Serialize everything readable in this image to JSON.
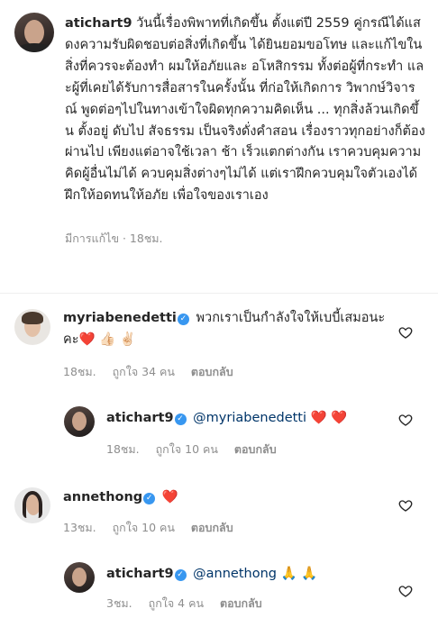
{
  "post": {
    "username": "atichart9",
    "text": "วันนี้เรื่องพิพาทที่เกิดขึ้น ตั้งแต่ปี 2559 คู่กรณีได้แสดงความรับผิดชอบต่อสิ่งที่เกิดขึ้น ได้ยินยอมขอโทษ และแก้ไขในสิ่งที่ควรจะต้องทำ ผมให้อภัยและ อโหสิกรรม ทั้งต่อผู้ที่กระทำ และผู้ที่เคยได้รับการสื่อสารในครั้งนั้น ที่ก่อให้เกิดการ วิพากษ์วิจารณ์ พูดต่อๆไปในทางเข้าใจผิดทุกความคิดเห็น ... ทุกสิ่งล้วนเกิดขึ้น ตั้งอยู่ ดับไป สัจธรรม เป็นจริงดั่งคำสอน เรื่องราวทุกอย่างก็ต้องผ่านไป เพียงแต่อาจใช้เวลา ช้า เร็วแตกต่างกัน เราควบคุมความคิดผู้อื่นไม่ได้ ควบคุมสิ่งต่างๆไม่ได้ แต่เราฝึกควบคุมใจตัวเองได้ ฝึกให้อดทนให้อภัย เพื่อใจของเราเอง",
    "meta": "มีการแก้ไข · 18ชม."
  },
  "comments": [
    {
      "username": "myriabenedetti",
      "text": "พวกเราเป็นกำลังใจให้เบบี้เสมอนะคะ",
      "emojis": "❤️ 👍🏻 ✌🏻",
      "time": "18ชม.",
      "likes": "ถูกใจ 34 คน",
      "reply": "ตอบกลับ"
    },
    {
      "username": "atichart9",
      "mention": "@myriabenedetti",
      "emojis": "❤️ ❤️",
      "time": "18ชม.",
      "likes": "ถูกใจ 10 คน",
      "reply": "ตอบกลับ"
    },
    {
      "username": "annethong",
      "emojis": "❤️",
      "time": "13ชม.",
      "likes": "ถูกใจ 10 คน",
      "reply": "ตอบกลับ"
    },
    {
      "username": "atichart9",
      "mention": "@annethong",
      "emojis": "🙏 🙏",
      "time": "3ชม.",
      "likes": "ถูกใจ 4 คน",
      "reply": "ตอบกลับ"
    }
  ],
  "colors": {
    "verified": "#3897f0",
    "heart": "#ed4956",
    "mention": "#003569",
    "muted": "#8e8e8e"
  }
}
